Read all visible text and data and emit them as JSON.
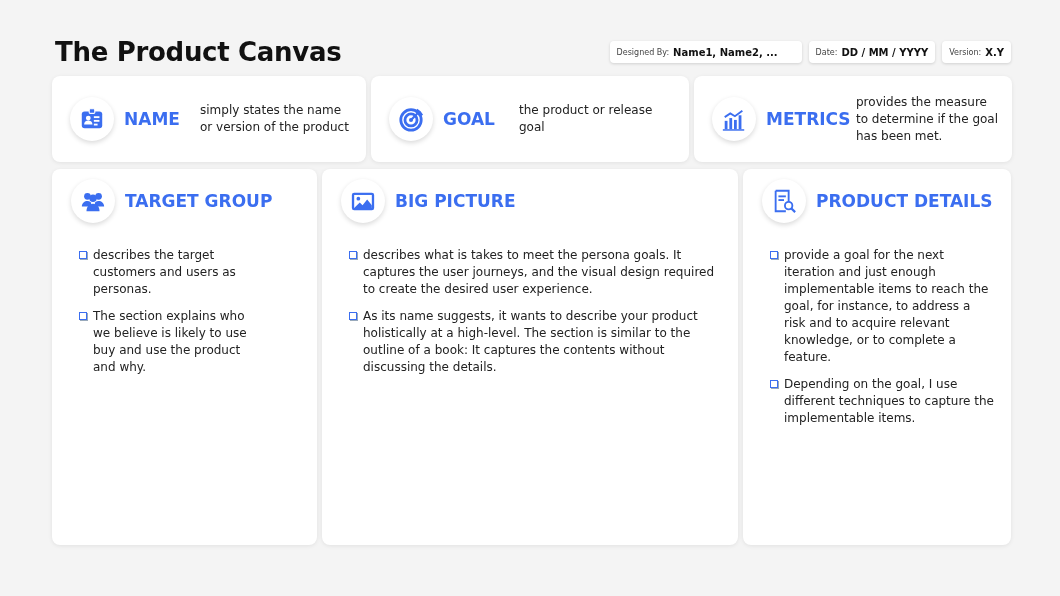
{
  "title": "The Product Canvas",
  "meta": [
    {
      "label": "Designed By:",
      "value": "Name1, Name2, ..."
    },
    {
      "label": "Date:",
      "value": "DD / MM / YYYY"
    },
    {
      "label": "Version:",
      "value": "X.Y"
    }
  ],
  "top_cards": [
    {
      "kind": "idcard",
      "heading": "NAME",
      "text": "simply states the name or version of the product"
    },
    {
      "kind": "target",
      "heading": "GOAL",
      "text": "the product or release goal"
    },
    {
      "kind": "chart",
      "heading": "METRICS",
      "text": "provides the measure to determine if the goal has been met."
    }
  ],
  "sections": [
    {
      "kind": "people",
      "heading": "TARGET GROUP",
      "bullets": [
        "describes the target customers and users as personas.",
        "The section explains who we believe is likely to use buy and use the product and why."
      ]
    },
    {
      "kind": "image",
      "heading": "BIG PICTURE",
      "bullets": [
        "describes what is takes to meet the persona goals. It captures the user journeys, and the visual design required to create the desired user experience.",
        "As its name suggests, it wants to describe your product holistically at a high-level. The section is similar to the outline of a book: It captures the contents without discussing the details."
      ]
    },
    {
      "kind": "docsearch",
      "heading": "PRODUCT DETAILS",
      "bullets": [
        "provide a goal for the next iteration and just enough implementable items to reach the goal, for instance, to address a risk and to acquire relevant knowledge, or to complete a feature.",
        "Depending on the goal, I use different techniques to capture the implementable items."
      ]
    }
  ]
}
